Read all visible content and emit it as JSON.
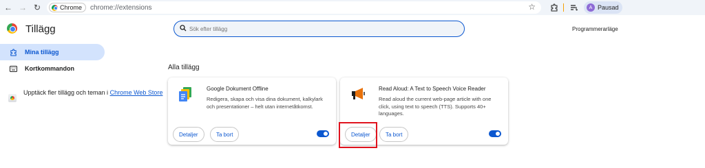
{
  "browser": {
    "chip_label": "Chrome",
    "url": "chrome://extensions",
    "profile_label": "Pausad",
    "avatar_letter": "A"
  },
  "header": {
    "title": "Tillägg",
    "search_placeholder": "Sök efter tillägg",
    "dev_mode_label": "Programmerarläge"
  },
  "sidebar": {
    "items": [
      {
        "label": "Mina tillägg",
        "icon": "puzzle-icon",
        "active": true
      },
      {
        "label": "Kortkommandon",
        "icon": "keyboard-icon",
        "active": false
      }
    ],
    "webstore_text": "Upptäck fler tillägg och teman i",
    "webstore_link": "Chrome Web Store"
  },
  "main": {
    "section_title": "Alla tillägg",
    "extensions": [
      {
        "name": "Google Dokument Offline",
        "description": "Redigera, skapa och visa dina dokument, kalkylark och presentationer – helt utan internetåtkomst.",
        "details_label": "Detaljer",
        "remove_label": "Ta bort",
        "enabled": true,
        "icon": "google-docs-offline-icon"
      },
      {
        "name": "Read Aloud: A Text to Speech Voice Reader",
        "description": "Read aloud the current web-page article with one click, using text to speech (TTS). Supports 40+ languages.",
        "details_label": "Detaljer",
        "remove_label": "Ta bort",
        "enabled": true,
        "icon": "megaphone-icon"
      }
    ]
  },
  "colors": {
    "accent": "#0b57d0",
    "highlight_box": "#e0121d",
    "active_nav_bg": "#d3e3fd"
  }
}
